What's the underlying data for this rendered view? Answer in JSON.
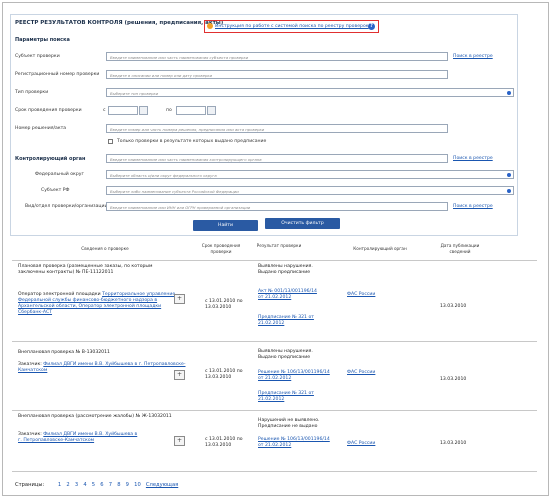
{
  "panel": {
    "title": "РЕЕСТР РЕЗУЛЬТАТОВ КОНТРОЛЯ (решения, предписания, акты)",
    "help_link": "Инструкция по работе с системой поиска по реестру проверок",
    "help_icon": "?",
    "section_search": "Параметры поиска",
    "section_org": "Контролирующий орган"
  },
  "search": {
    "subject_label": "Субъект проверки",
    "subject_placeholder": "Введите наименование или часть наименования субъекта проверки",
    "subject_link": "Поиск в реестре",
    "reg_label": "Регистрационный номер проверки",
    "reg_placeholder": "Введите в описании или номер или дату проверки",
    "type_label": "Тип проверки",
    "type_value": "Выберите тип проверки",
    "period_label": "Срок проведения проверки",
    "period_from": "с",
    "period_to": "по",
    "decision_label": "Номер решения/акта",
    "decision_placeholder": "Введите номер или часть номера решения, предписания или акта проверки",
    "checkbox_label": "Только проверки в результате которых выдано предписание"
  },
  "org": {
    "name_placeholder": "Введите наименование или часть наименования контролирующего органа",
    "name_link": "Поиск в реестре",
    "district_label": "Федеральный округ",
    "district_value": "Выберите область и/или округ федерального округа",
    "region_label": "Субъект РФ",
    "region_value": "Выберите либо наименование субъекта Российской Федерации",
    "org_label": "Вид/отдел проверки/организации",
    "org_placeholder": "Введите наименование или ИНН или ОГРН проверяемой организации",
    "org_link": "Поиск в реестре"
  },
  "buttons": {
    "find": "Найти",
    "reset": "Очистить фильтр"
  },
  "table": {
    "headers": [
      "Сведения о проверке",
      "Срок проведения проверки",
      "Результат проверки",
      "Контролирующий орган",
      "Дата публикации сведений"
    ],
    "rows": [
      {
        "title": "Плановая проверка (размещенные заказы, по которым заключены контракты) № ПЕ-11122011",
        "subject_prefix": "Оператор электронной площадки",
        "subject": "Территориальное управление Федеральной службы финансово-бюджетного надзора в Архангельской области, Оператор электронной площадки Сбербанк-АСТ",
        "expand": "+",
        "period": "с 13.01.2010 по 13.03.2010",
        "result": "Выявлены нарушения. Выдано предписание",
        "doc1": "Акт № 001/13/001196/14 от 21.02.2012",
        "doc2": "Предписание № 321 от 21.02.2012",
        "authority": "ФАС России",
        "date": "13.03.2010"
      },
      {
        "title": "Внеплановая проверка № В-13032011",
        "subject_prefix": "Заказчик:",
        "subject": "Филиал ДВГИ имени В.В. Хуйбышева в г. Петропавловске-Камчатском",
        "expand": "+",
        "period": "с 13.01.2010 по 13.03.2010",
        "result": "Выявлены нарушения. Выдано предписание",
        "doc1": "Решение № 106/13/001196/14 от 21.02.2012",
        "doc2": "Предписание № 321 от 21.02.2012",
        "authority": "ФАС России",
        "date": "13.03.2010"
      },
      {
        "title": "Внеплановая проверка (рассмотрение жалобы) № Ж-13032011",
        "subject_prefix": "Заказчик:",
        "subject": "Филиал ДВГИ имени В.В. Хуйбышева в г. Петропавловске-Камчатском",
        "expand": "+",
        "period": "с 13.01.2010 по 13.03.2010",
        "result": "Нарушений не выявлено. Предписание не выдано",
        "doc1": "Решение № 106/13/001196/14 от 21.02.2012",
        "doc2": "",
        "authority": "ФАС России",
        "date": "13.03.2010"
      }
    ]
  },
  "pager": {
    "label": "Страницы:",
    "pages": [
      "1",
      "2",
      "3",
      "4",
      "5",
      "6",
      "7",
      "8",
      "9",
      "10"
    ],
    "next": "Следующая"
  }
}
